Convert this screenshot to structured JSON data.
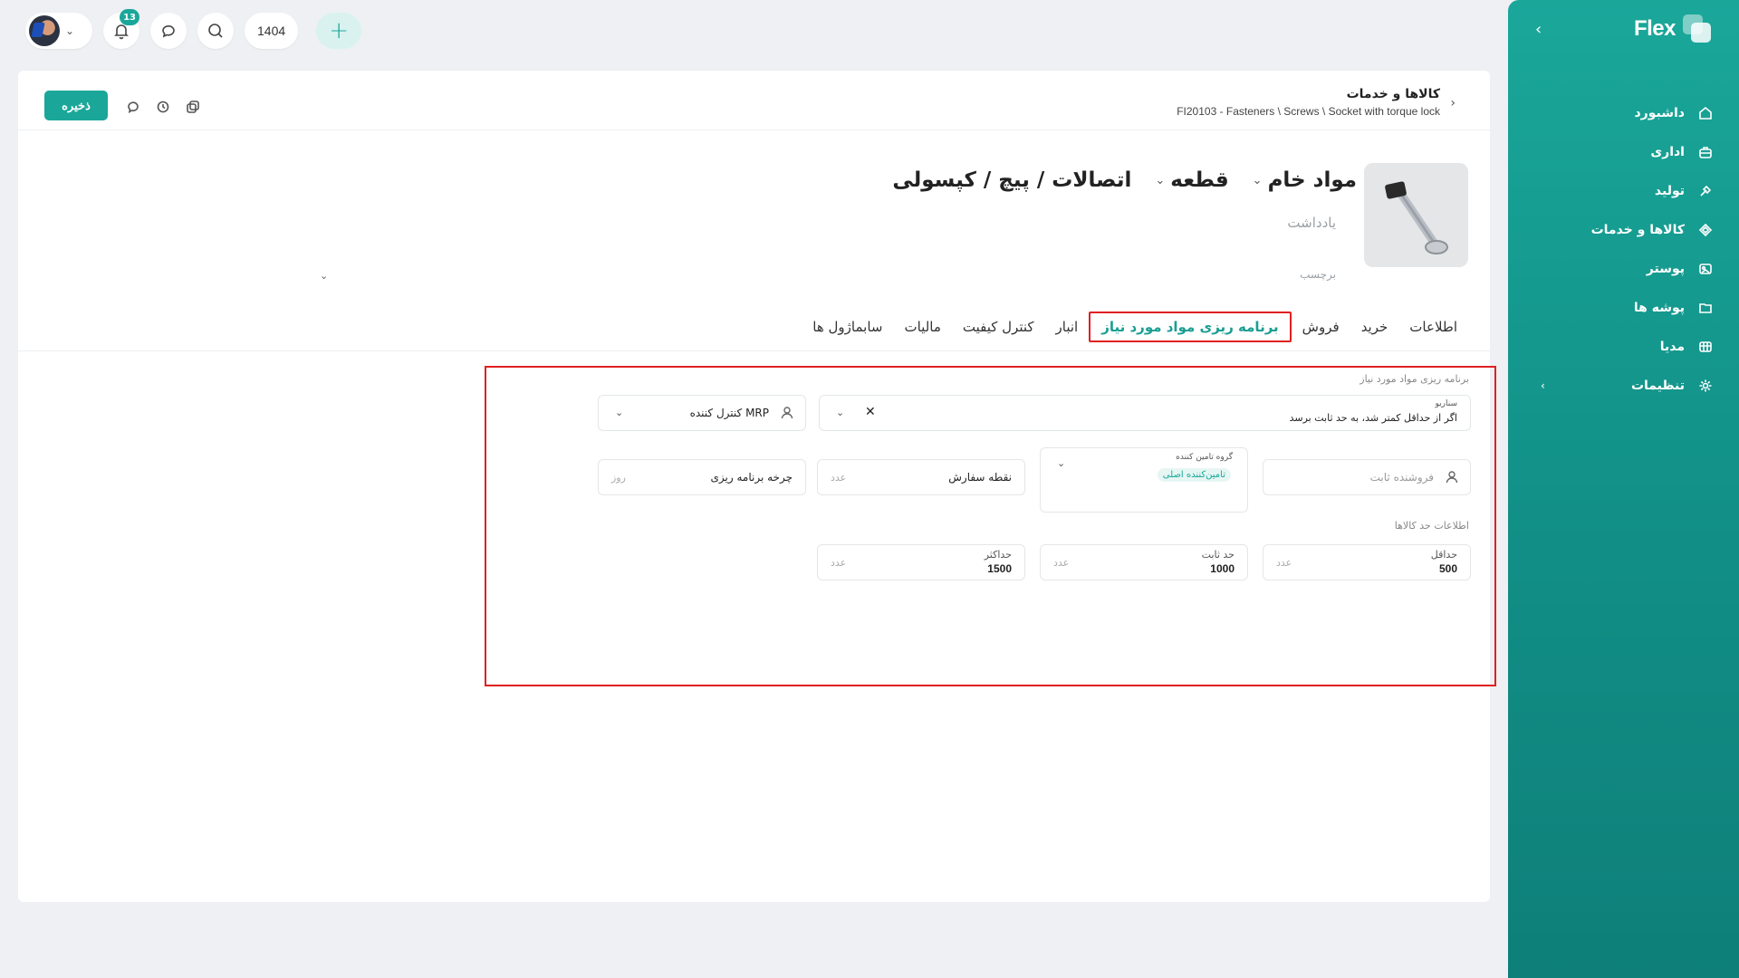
{
  "sidebar": {
    "brand": "Flex",
    "items": [
      {
        "label": "داشبورد",
        "icon": "home-icon"
      },
      {
        "label": "اداری",
        "icon": "briefcase-icon"
      },
      {
        "label": "تولید",
        "icon": "tools-icon"
      },
      {
        "label": "کالاها و خدمات",
        "icon": "box-icon"
      },
      {
        "label": "پوستر",
        "icon": "image-icon"
      },
      {
        "label": "پوشه ها",
        "icon": "folder-icon"
      },
      {
        "label": "مدیا",
        "icon": "media-icon"
      },
      {
        "label": "تنظیمات",
        "icon": "gear-icon"
      }
    ]
  },
  "topbar": {
    "notification_count": "13",
    "year": "1404"
  },
  "header": {
    "save_label": "ذخیره",
    "title": "کالاها و خدمات",
    "path": "FI20103 - Fasteners \\ Screws \\ Socket with torque lock"
  },
  "product": {
    "type": "مواد خام",
    "kind": "قطعه",
    "name": "اتصالات / پیچ / کپسولی",
    "note_placeholder": "یادداشت",
    "tag_placeholder": "برچسب"
  },
  "tabs": [
    {
      "label": "اطلاعات",
      "active": false
    },
    {
      "label": "خرید",
      "active": false
    },
    {
      "label": "فروش",
      "active": false
    },
    {
      "label": "برنامه ریزی مواد مورد نیاز",
      "active": true
    },
    {
      "label": "انبار",
      "active": false
    },
    {
      "label": "کنترل کیفیت",
      "active": false
    },
    {
      "label": "مالیات",
      "active": false
    },
    {
      "label": "سابماژول ها",
      "active": false
    }
  ],
  "mrp": {
    "section_title": "برنامه ریزی مواد مورد نیاز",
    "scenario_label": "سناریو",
    "scenario_value": "اگر از حداقل کمتر شد، به حد ثابت برسد",
    "controller_label": "کنترل کننده MRP",
    "fixed_vendor_placeholder": "فروشنده ثابت",
    "supplier_group_label": "گروه تامین کننده",
    "supplier_group_chip": "تامین‌کننده اصلی",
    "order_point_label": "نقطه سفارش",
    "order_point_unit": "عدد",
    "planning_cycle_label": "چرخه برنامه ریزی",
    "planning_cycle_unit": "روز",
    "limits_title": "اطلاعات حد کالاها",
    "min_label": "حداقل",
    "min_value": "500",
    "min_unit": "عدد",
    "fixed_label": "حد ثابت",
    "fixed_value": "1000",
    "fixed_unit": "عدد",
    "max_label": "حداکثر",
    "max_value": "1500",
    "max_unit": "عدد"
  },
  "colors": {
    "accent": "#1aa79a",
    "highlight_border": "#e02020"
  }
}
